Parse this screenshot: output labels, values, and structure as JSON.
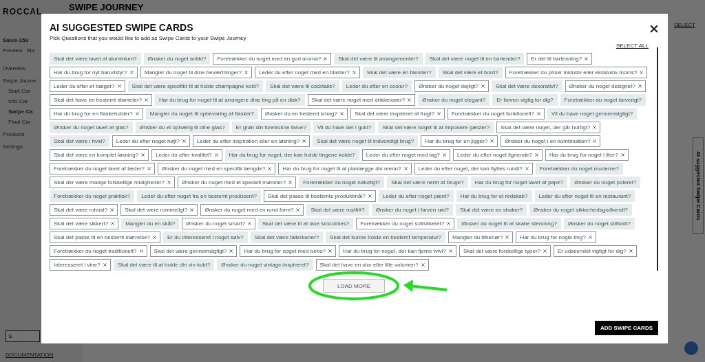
{
  "page": {
    "logo": "ROCCAL",
    "heading": "SWIPE JOURNEY",
    "top_link": "SELECT",
    "project": "Sales-158",
    "actions": [
      "Preview",
      "Sta"
    ],
    "nav": [
      {
        "label": "Overview",
        "selected": false
      },
      {
        "label": "Swipe Journe",
        "selected": false,
        "children": [
          {
            "label": "Start Car",
            "selected": false
          },
          {
            "label": "Info Car",
            "selected": false
          },
          {
            "label": "Swipe Ca",
            "selected": true
          },
          {
            "label": "Final Car",
            "selected": false
          }
        ]
      },
      {
        "label": "Products",
        "selected": false
      },
      {
        "label": "Settings",
        "selected": false
      }
    ],
    "bottom_button": "S",
    "documentation": "DOCUMENTATION",
    "side_tab": "AI suggested Swipe Cards"
  },
  "modal": {
    "title": "AI SUGGESTED SWIPE CARDS",
    "subtitle": "Pick Questions that you would like to add as Swipe Cards to your Swipe Journey",
    "select_all": "SELECT ALL",
    "cards": [
      {
        "text": "Skal det være lavet af aluminium?",
        "selected": false
      },
      {
        "text": "Ønsker du noget antikt?",
        "selected": false
      },
      {
        "text": "Foretrækker du noget med en god aroma?",
        "selected": true
      },
      {
        "text": "Skal det være til arrangementer?",
        "selected": false
      },
      {
        "text": "Skal det være noget til en bartender?",
        "selected": false
      },
      {
        "text": "Er det til bartending?",
        "selected": true
      },
      {
        "text": "Har du brug for nyt barudstyr?",
        "selected": true
      },
      {
        "text": "Mangler du noget til dine beværtninger?",
        "selected": true
      },
      {
        "text": "Leder du efter noget med en blaster?",
        "selected": true
      },
      {
        "text": "Skal det være en blender?",
        "selected": false
      },
      {
        "text": "Skal det være et bord?",
        "selected": false
      },
      {
        "text": "Foretrækker du priser inklusiv eller eksklusiv moms?",
        "selected": true
      },
      {
        "text": "Leder du efter et bæger?",
        "selected": true
      },
      {
        "text": "Skal det være specifikt til at holde champagne kold?",
        "selected": false
      },
      {
        "text": "Skal det være til cocktails?",
        "selected": false
      },
      {
        "text": "Leder du efter en cooler?",
        "selected": false
      },
      {
        "text": "Ønsker du noget dejligt?",
        "selected": true
      },
      {
        "text": "Skal det være dekorativt?",
        "selected": false
      },
      {
        "text": "Ønsker du noget designet?",
        "selected": true
      },
      {
        "text": "Skal det have en bestemt diameter?",
        "selected": true
      },
      {
        "text": "Har du brug for noget til at arrangere dine ting på en disk?",
        "selected": false
      },
      {
        "text": "Skal det være noget med drikkevarer?",
        "selected": true
      },
      {
        "text": "Ønsker du noget elegant?",
        "selected": false
      },
      {
        "text": "Er farven vigtig for dig?",
        "selected": false
      },
      {
        "text": "Foretrækker du noget farverigt?",
        "selected": false
      },
      {
        "text": "Har du brug for en flaskeholder?",
        "selected": true
      },
      {
        "text": "Mangler du noget til opbevaring af flasker?",
        "selected": false
      },
      {
        "text": "Ønsker du en bestemt smag?",
        "selected": true
      },
      {
        "text": "Skal det være inspireret af frugt?",
        "selected": true
      },
      {
        "text": "Foretrækker du noget funktionelt?",
        "selected": true
      },
      {
        "text": "Vil du have noget gennemsigtigt?",
        "selected": false
      },
      {
        "text": "Ønsker du noget lavet af glas?",
        "selected": false
      },
      {
        "text": "Ønsker du et ophæng til dine glas?",
        "selected": false
      },
      {
        "text": "Er grøn din foretrukne farve?",
        "selected": false
      },
      {
        "text": "Vil du have det i guld?",
        "selected": false
      },
      {
        "text": "Skal det være noget til at imponere gæster?",
        "selected": false
      },
      {
        "text": "Skal det være noget, der går hurtigt?",
        "selected": true
      },
      {
        "text": "Skal det være i hvid?",
        "selected": false
      },
      {
        "text": "Leder du efter noget højt?",
        "selected": true
      },
      {
        "text": "Leder du efter inspiration eller en løsning?",
        "selected": true
      },
      {
        "text": "Skal det være noget til indvendigt brug?",
        "selected": false
      },
      {
        "text": "Har du brug for en jigger?",
        "selected": true
      },
      {
        "text": "Ønsker du noget i en kombination?",
        "selected": true
      },
      {
        "text": "Skal det være en komplet løsning?",
        "selected": true
      },
      {
        "text": "Leder du efter kvalitet?",
        "selected": true
      },
      {
        "text": "Har du brug for noget, der kan holde tingene kolde?",
        "selected": false
      },
      {
        "text": "Leder du efter noget med lag?",
        "selected": true
      },
      {
        "text": "Leder du efter noget lignende?",
        "selected": true
      },
      {
        "text": "Har du brug for noget i liter?",
        "selected": true
      },
      {
        "text": "Foretrækker du noget lavet af læder?",
        "selected": true
      },
      {
        "text": "Ønsker du noget med en specifik længde?",
        "selected": true
      },
      {
        "text": "Har du brug for noget til at planlægge din menu?",
        "selected": true
      },
      {
        "text": "Leder du efter noget, der kan flyttes rundt?",
        "selected": true
      },
      {
        "text": "Foretrækker du noget moderne?",
        "selected": false
      },
      {
        "text": "Skal der være mange forskellige muligheder?",
        "selected": true
      },
      {
        "text": "Ønsker du noget med et specielt mønster?",
        "selected": true
      },
      {
        "text": "Foretrækker du noget naturligt?",
        "selected": false
      },
      {
        "text": "Skal det være nemt at bruge?",
        "selected": false
      },
      {
        "text": "Har du brug for noget lavet af papir?",
        "selected": false
      },
      {
        "text": "Ønsker du noget poleret?",
        "selected": false
      },
      {
        "text": "Foretrækker du noget praktisk?",
        "selected": false
      },
      {
        "text": "Leder du efter noget fra en bestemt producent?",
        "selected": false
      },
      {
        "text": "Skal det passe til bestemte produktmål?",
        "selected": true
      },
      {
        "text": "Leder du efter noget pænt?",
        "selected": false
      },
      {
        "text": "Har du brug for et redskab?",
        "selected": false
      },
      {
        "text": "Leder du efter noget til en restaurant?",
        "selected": false
      },
      {
        "text": "Skal det være robust?",
        "selected": true
      },
      {
        "text": "Skal det være rummeligt?",
        "selected": true
      },
      {
        "text": "Ønsker du noget med en rund form?",
        "selected": true
      },
      {
        "text": "Skal det være rustfrit?",
        "selected": false
      },
      {
        "text": "Ønsker du noget i farven rød?",
        "selected": false
      },
      {
        "text": "Skal det være en shaker?",
        "selected": false
      },
      {
        "text": "Ønsker du noget sikkerhedsgodkendt?",
        "selected": false
      },
      {
        "text": "Skal det være sikkert?",
        "selected": true
      },
      {
        "text": "Mangler du en skål?",
        "selected": false
      },
      {
        "text": "Ønsker du noget smart?",
        "selected": true
      },
      {
        "text": "Skal det være til at lave smoothies?",
        "selected": false
      },
      {
        "text": "Foretrækker du noget sofistikeret?",
        "selected": true
      },
      {
        "text": "Ønsker du noget til at skabe stemning?",
        "selected": false
      },
      {
        "text": "Ønsker du noget stilfuldt?",
        "selected": false
      },
      {
        "text": "Skal det passe til en bestemt størrelse?",
        "selected": true
      },
      {
        "text": "Er du interesseret i noget sølv?",
        "selected": false
      },
      {
        "text": "Skal det være tallerkener?",
        "selected": false
      },
      {
        "text": "Skal det kunne holde en bestemt temperatur?",
        "selected": false
      },
      {
        "text": "Mangler du tilbehør?",
        "selected": true
      },
      {
        "text": "Har du brug for nogle ting?",
        "selected": true
      },
      {
        "text": "Foretrækker du noget traditionelt?",
        "selected": true
      },
      {
        "text": "Skal det være gennemsigtigt?",
        "selected": true
      },
      {
        "text": "Har du brug for noget med turbo?",
        "selected": true
      },
      {
        "text": "Har du brug for noget, der kan fjerne tvivl?",
        "selected": true
      },
      {
        "text": "Skal det være forskellige typer?",
        "selected": true
      },
      {
        "text": "Er udseendet vigtigt for dig?",
        "selected": true
      },
      {
        "text": "Interesseret i vine?",
        "selected": true
      },
      {
        "text": "Skal det være til at holde din vin kold?",
        "selected": false
      },
      {
        "text": "Ønsker du noget vintage-inspireret?",
        "selected": false
      },
      {
        "text": "Skal det have en stor eller lille volumen?",
        "selected": true
      }
    ],
    "load_more": "LOAD MORE",
    "add_button": "ADD SWIPE CARDS"
  }
}
